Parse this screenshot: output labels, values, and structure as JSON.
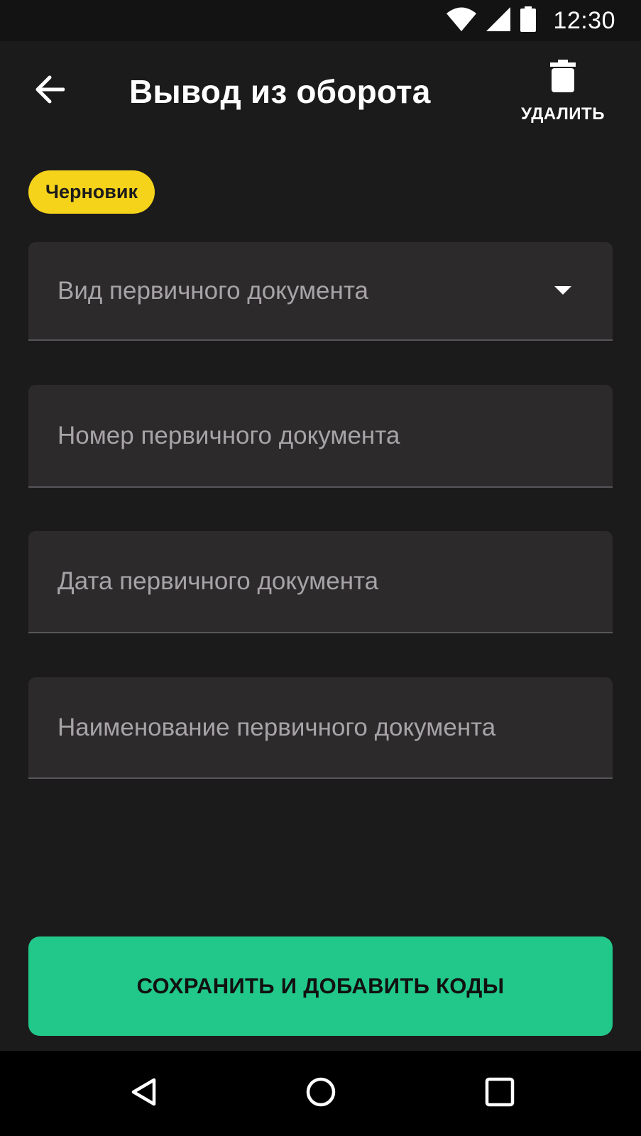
{
  "status_bar": {
    "time": "12:30",
    "icons": [
      "wifi-icon",
      "cellular-signal-icon",
      "battery-icon"
    ]
  },
  "app_bar": {
    "back_icon": "arrow-left-icon",
    "title": "Вывод из оборота",
    "delete_icon": "trash-icon",
    "delete_label": "УДАЛИТЬ"
  },
  "status_chip": {
    "label": "Черновик",
    "color": "#f5d31b"
  },
  "form": {
    "document_type": {
      "placeholder": "Вид первичного документа",
      "value": "",
      "icon": "arrow-drop-down-icon"
    },
    "document_number": {
      "placeholder": "Номер первичного документа",
      "value": ""
    },
    "document_date": {
      "placeholder": "Дата первичного документа",
      "value": ""
    },
    "document_name": {
      "placeholder": "Наименование первичного документа",
      "value": ""
    }
  },
  "primary_button": {
    "label": "СОХРАНИТЬ И ДОБАВИТЬ КОДЫ",
    "color": "#21c88a"
  },
  "nav_bar": {
    "icons": [
      "nav-back-triangle-icon",
      "nav-home-circle-icon",
      "nav-recents-square-icon"
    ]
  },
  "theme": {
    "background": "#1c1b1c",
    "field_background": "#2d2a2c",
    "placeholder_text": "#a7a4a8"
  }
}
